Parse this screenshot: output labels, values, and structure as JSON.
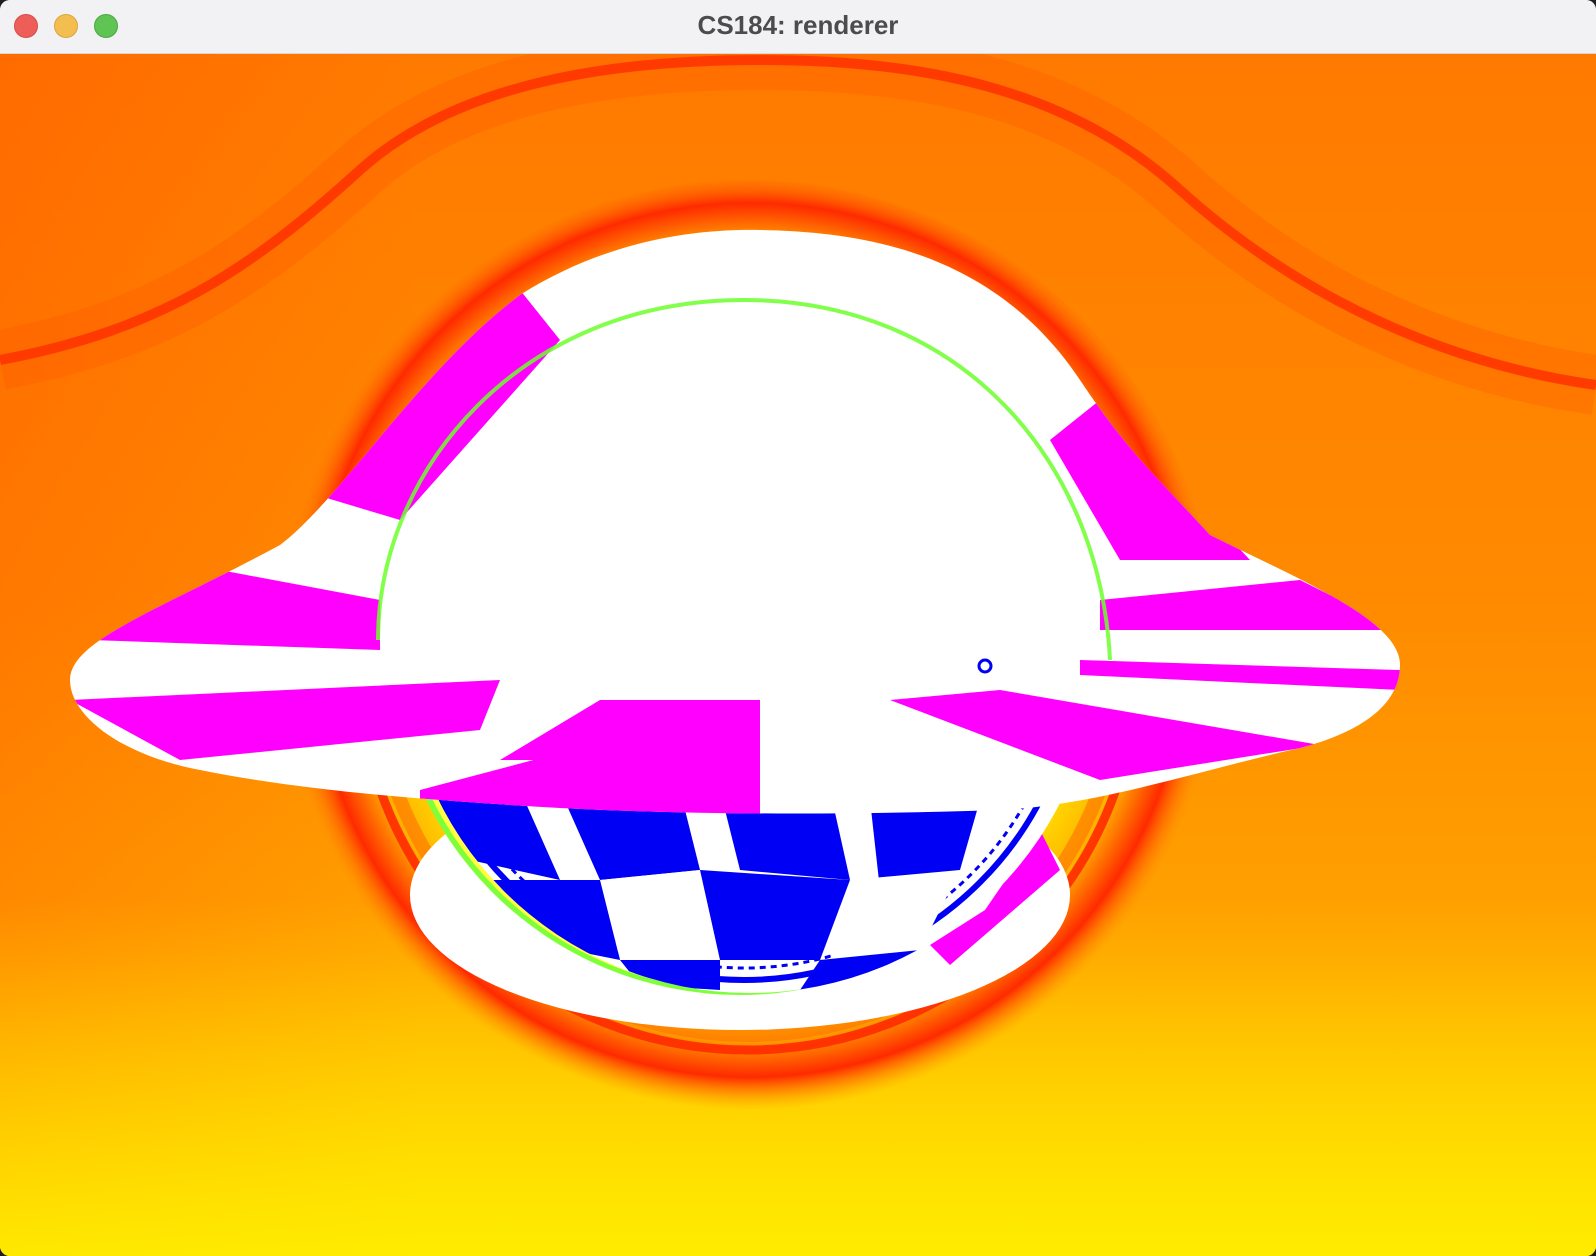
{
  "window": {
    "title": "CS184: renderer",
    "controls": [
      "close-button",
      "minimize-button",
      "zoom-button"
    ]
  },
  "render": {
    "colors": {
      "background_orange": "#ff9000",
      "background_red": "#ff2a00",
      "background_yellow": "#ffee00",
      "checker_blue": "#0000f5",
      "checker_white": "#ffffff",
      "disk_magenta": "#ff00ff"
    }
  }
}
